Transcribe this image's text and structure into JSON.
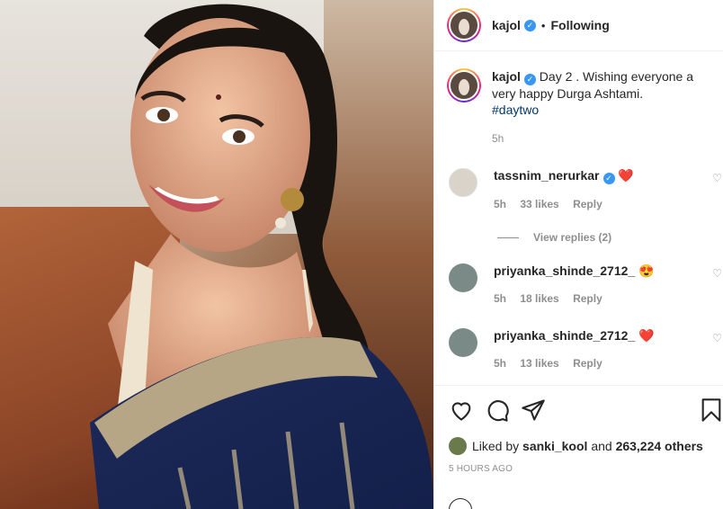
{
  "header": {
    "username": "kajol",
    "dot": "•",
    "follow_label": "Following"
  },
  "caption": {
    "username": "kajol",
    "text": "Day 2 . Wishing everyone a very happy Durga Ashtami.",
    "hashtag": "#daytwo",
    "time": "5h"
  },
  "comments": [
    {
      "username": "tassnim_nerurkar",
      "emoji": "❤️",
      "time": "5h",
      "likes": "33 likes",
      "reply": "Reply",
      "avatar_color": "#d9d3c9"
    },
    {
      "username": "priyanka_shinde_2712_",
      "emoji": "😍",
      "time": "5h",
      "likes": "18 likes",
      "reply": "Reply",
      "avatar_color": "#7a8a86"
    },
    {
      "username": "priyanka_shinde_2712_",
      "emoji": "❤️",
      "time": "5h",
      "likes": "13 likes",
      "reply": "Reply",
      "avatar_color": "#7a8a86"
    }
  ],
  "view_replies": "View replies (2)",
  "likes": {
    "prefix": "Liked by",
    "user": "sanki_kool",
    "and": "and",
    "count": "263,224 others"
  },
  "posted_ago": "5 HOURS AGO",
  "icons": {
    "like": "heart-icon",
    "comment": "comment-icon",
    "share": "share-icon",
    "save": "bookmark-icon"
  }
}
